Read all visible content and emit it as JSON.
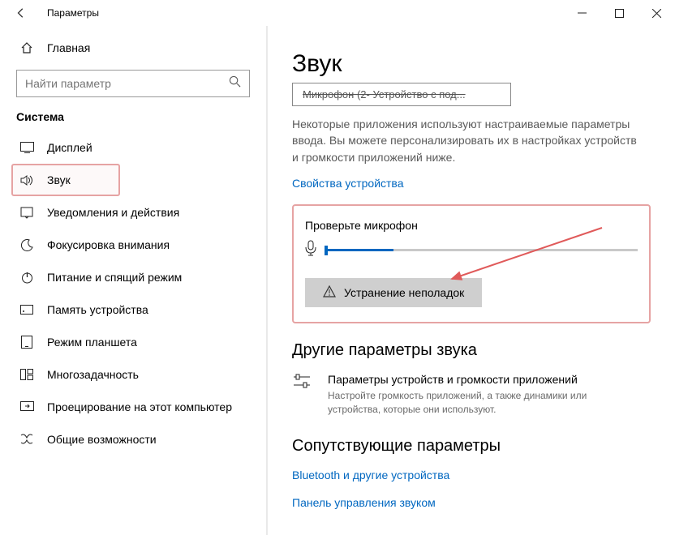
{
  "window": {
    "title": "Параметры"
  },
  "sidebar": {
    "home": "Главная",
    "search_placeholder": "Найти параметр",
    "section": "Система",
    "items": [
      {
        "label": "Дисплей"
      },
      {
        "label": "Звук"
      },
      {
        "label": "Уведомления и действия"
      },
      {
        "label": "Фокусировка внимания"
      },
      {
        "label": "Питание и спящий режим"
      },
      {
        "label": "Память устройства"
      },
      {
        "label": "Режим планшета"
      },
      {
        "label": "Многозадачность"
      },
      {
        "label": "Проецирование на этот компьютер"
      },
      {
        "label": "Общие возможности"
      }
    ]
  },
  "main": {
    "heading": "Звук",
    "dropdown_value": "Микрофон (2- Устройство с под...",
    "paragraph": "Некоторые приложения используют настраиваемые параметры ввода. Вы можете персонализировать их в настройках устройств и громкости приложений ниже.",
    "device_props_link": "Свойства устройства",
    "check_mic_label": "Проверьте микрофон",
    "troubleshoot_label": "Устранение неполадок",
    "other_params_heading": "Другие параметры звука",
    "volume_title": "Параметры устройств и громкости приложений",
    "volume_desc": "Настройте громкость приложений, а также динамики или устройства, которые они используют.",
    "related_heading": "Сопутствующие параметры",
    "bluetooth_link": "Bluetooth и другие устройства",
    "control_panel_link": "Панель управления звуком"
  }
}
